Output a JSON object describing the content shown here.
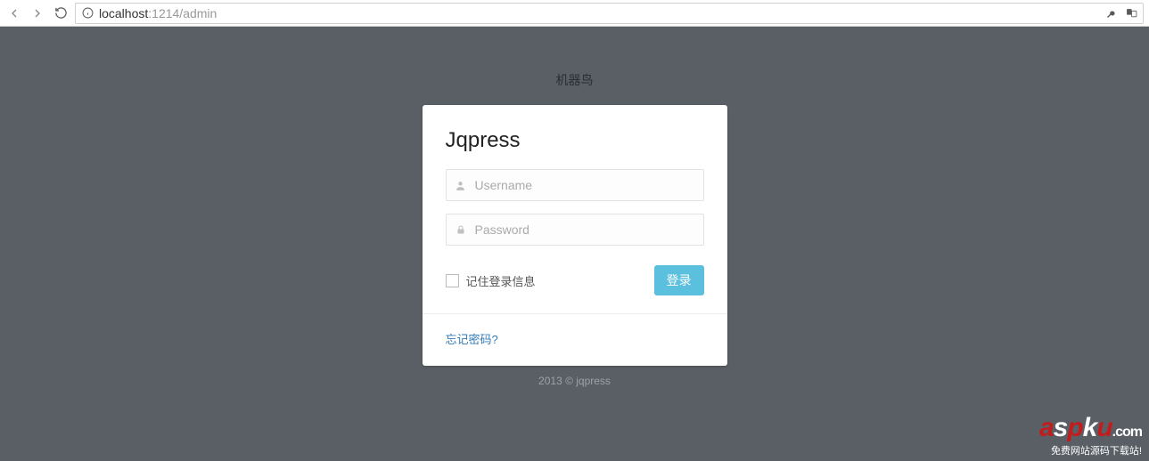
{
  "browser": {
    "url_scheme_host": "localhost",
    "url_rest": ":1214/admin"
  },
  "site": {
    "name": "机器鸟"
  },
  "login": {
    "title": "Jqpress",
    "username_placeholder": "Username",
    "password_placeholder": "Password",
    "remember_label": "记住登录信息",
    "submit_label": "登录",
    "forgot_label": "忘记密码?"
  },
  "footer": {
    "copyright": "2013 © jqpress"
  },
  "watermark": {
    "text": "aspku",
    "domain": ".com",
    "tagline": "免费网站源码下载站!"
  }
}
